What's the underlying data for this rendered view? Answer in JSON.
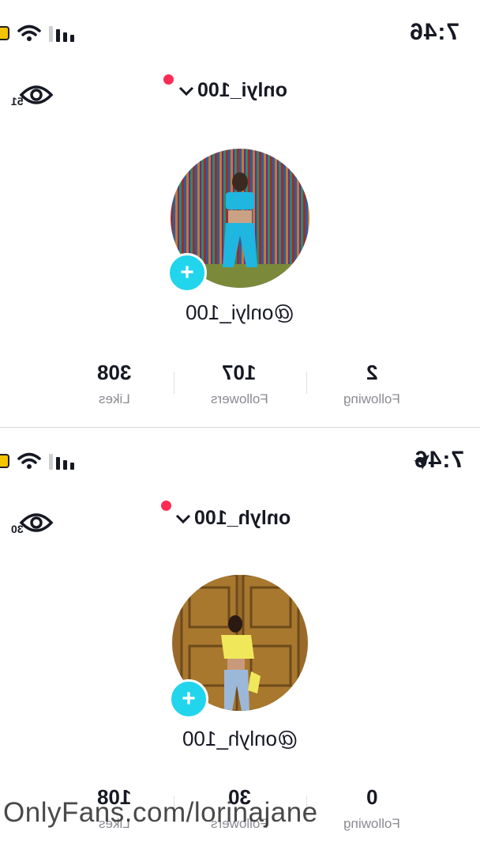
{
  "panels": [
    {
      "status_bar": {
        "time": "7:46",
        "location_arrow": false
      },
      "header": {
        "username": "onlyi_100",
        "view_count": "51"
      },
      "profile": {
        "handle": "@onlyi_100"
      },
      "stats": {
        "following": {
          "value": "2",
          "label": "Following"
        },
        "followers": {
          "value": "107",
          "label": "Followers"
        },
        "likes": {
          "value": "308",
          "label": "Likes"
        }
      }
    },
    {
      "status_bar": {
        "time": "7:46",
        "location_arrow": true
      },
      "header": {
        "username": "onlyh_100",
        "view_count": "30"
      },
      "profile": {
        "handle": "@onlyh_100"
      },
      "stats": {
        "following": {
          "value": "0",
          "label": "Following"
        },
        "followers": {
          "value": "30",
          "label": "Followers"
        },
        "likes": {
          "value": "108",
          "label": "Likes"
        }
      }
    }
  ],
  "watermark": "OnlyFans.com/lorinajane",
  "colors": {
    "accent_add": "#20d5ec",
    "notification_dot": "#fe2c55",
    "battery": "#f5c400",
    "label_gray": "#8a8b91"
  },
  "icons": [
    "eye-icon",
    "wifi-icon",
    "signal-icon",
    "battery-icon",
    "chevron-down-icon",
    "plus-icon",
    "location-arrow-icon"
  ]
}
